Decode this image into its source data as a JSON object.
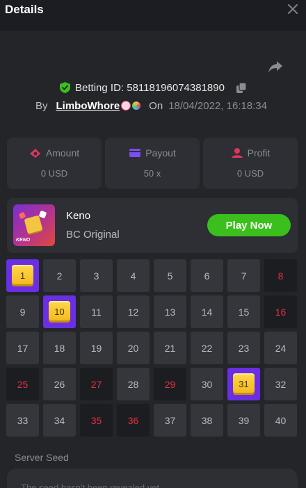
{
  "header": {
    "title": "Details",
    "close_icon": "close-icon"
  },
  "bet": {
    "betting_id_label": "Betting ID: 58118196074381890",
    "by_label": "By",
    "username": "LimboWhore",
    "on_label": "On",
    "date": "18/04/2022, 16:18:34"
  },
  "stats": [
    {
      "label": "Amount",
      "value": "0 USD",
      "icon": "cash-icon",
      "color": "#e0355f"
    },
    {
      "label": "Payout",
      "value": "50 x",
      "icon": "wallet-icon",
      "color": "#7a4ff0"
    },
    {
      "label": "Profit",
      "value": "0 USD",
      "icon": "profit-icon",
      "color": "#e0355f"
    }
  ],
  "game": {
    "name": "Keno",
    "subtitle": "BC Original",
    "thumb_text": "KENO",
    "play_label": "Play Now"
  },
  "keno": {
    "numbers": [
      "1",
      "2",
      "3",
      "4",
      "5",
      "6",
      "7",
      "8",
      "9",
      "10",
      "11",
      "12",
      "13",
      "14",
      "15",
      "16",
      "17",
      "18",
      "19",
      "20",
      "21",
      "22",
      "23",
      "24",
      "25",
      "26",
      "27",
      "28",
      "29",
      "30",
      "31",
      "32",
      "33",
      "34",
      "35",
      "36",
      "37",
      "38",
      "39",
      "40"
    ],
    "hits": [
      "1",
      "10",
      "31"
    ],
    "drawn": [
      "8",
      "16",
      "25",
      "27",
      "29",
      "35",
      "36"
    ]
  },
  "seed": {
    "label": "Server Seed",
    "placeholder": "The seed hasn't been revealed yet"
  },
  "colors": {
    "accent_green": "#3bbf1c",
    "hit_purple": "#6a2fe3",
    "drawn_red": "#e5303f"
  }
}
